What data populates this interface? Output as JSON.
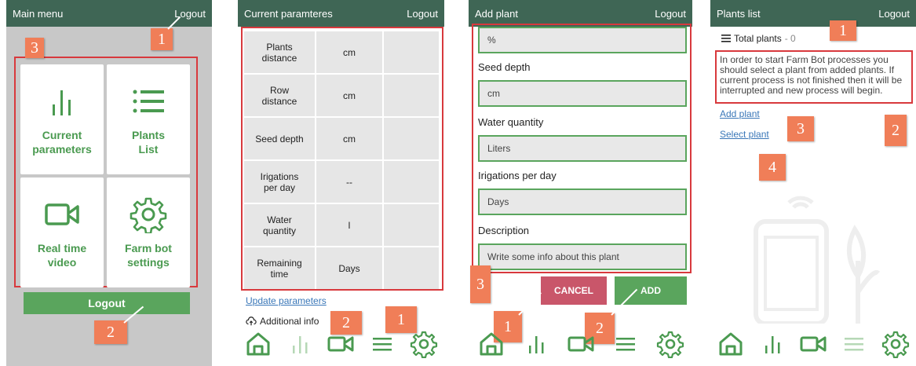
{
  "panel1": {
    "title": "Main menu",
    "logout": "Logout",
    "tiles": [
      {
        "label": "Current\nparameters",
        "icon": "bar-chart-icon"
      },
      {
        "label": "Plants\nList",
        "icon": "list-icon"
      },
      {
        "label": "Real time\nvideo",
        "icon": "video-camera-icon"
      },
      {
        "label": "Farm bot\nsettings",
        "icon": "gear-icon"
      }
    ],
    "logout_button": "Logout",
    "badges": [
      "1",
      "2",
      "3"
    ]
  },
  "panel2": {
    "title": "Current paramteres",
    "logout": "Logout",
    "rows": [
      {
        "name": "Plants\ndistance",
        "unit": "cm",
        "value": ""
      },
      {
        "name": "Row\ndistance",
        "unit": "cm",
        "value": ""
      },
      {
        "name": "Seed depth",
        "unit": "cm",
        "value": ""
      },
      {
        "name": "Irigations\nper day",
        "unit": "--",
        "value": ""
      },
      {
        "name": "Water\nquantity",
        "unit": "l",
        "value": ""
      },
      {
        "name": "Remaining\ntime",
        "unit": "Days",
        "value": ""
      }
    ],
    "update_link": "Update parameters",
    "additional_info": "Additional info",
    "badges": [
      "1",
      "2"
    ]
  },
  "panel3": {
    "title": "Add plant",
    "logout": "Logout",
    "first_field_placeholder": "%",
    "fields": [
      {
        "label": "Seed depth",
        "placeholder": "cm"
      },
      {
        "label": "Water quantity",
        "placeholder": "Liters"
      },
      {
        "label": "Irigations per day",
        "placeholder": "Days"
      },
      {
        "label": "Description",
        "placeholder": "Write some info about this plant"
      }
    ],
    "cancel": "CANCEL",
    "add": "ADD",
    "badges": [
      "1",
      "2",
      "3"
    ]
  },
  "panel4": {
    "title": "Plants list",
    "logout": "Logout",
    "total_label": "Total plants",
    "total_count": "- 0",
    "info": "In order to start Farm Bot processes you should select a plant from added plants. If current process is not finished then it will be interrupted and new process will begin.",
    "add_plant": "Add plant",
    "select_plant": "Select plant",
    "badges": [
      "1",
      "2",
      "3",
      "4"
    ]
  },
  "colors": {
    "appbar": "#3f6655",
    "accent_green": "#5aa55d",
    "cancel_red": "#c9566a",
    "highlight_red": "#d8393d",
    "badge": "#f07e58"
  }
}
